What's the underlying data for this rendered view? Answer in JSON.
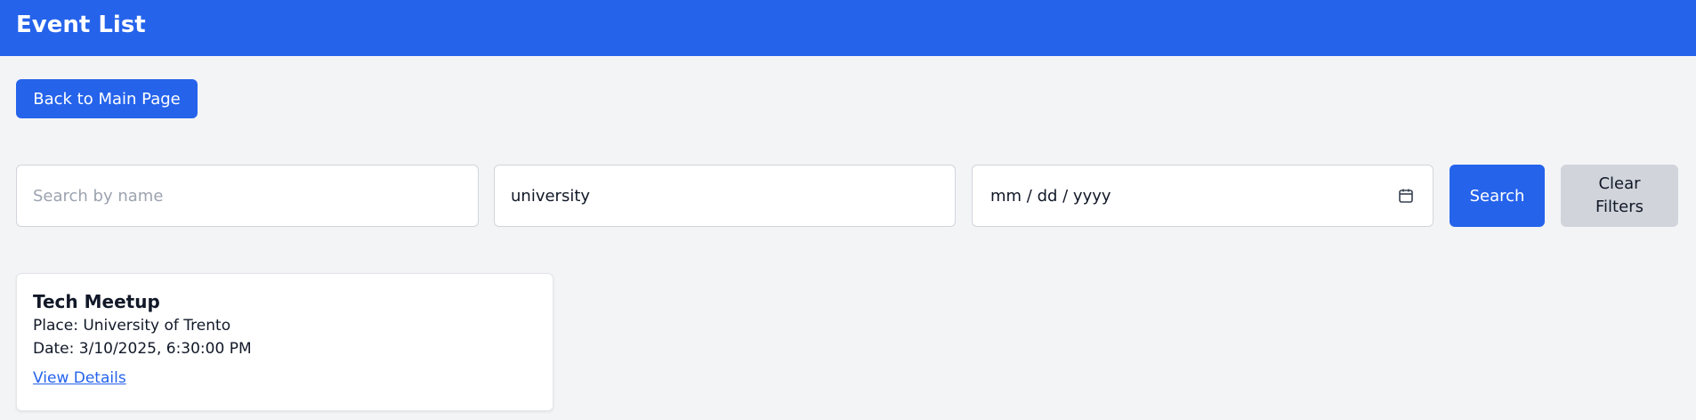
{
  "header": {
    "title": "Event List",
    "color": "#2563eb"
  },
  "nav": {
    "back_label": "Back to Main Page"
  },
  "filters": {
    "name": {
      "placeholder": "Search by name",
      "value": ""
    },
    "place": {
      "placeholder": "",
      "value": "university"
    },
    "date": {
      "value_display": "mm / dd / yyyy",
      "icon": "calendar-icon"
    },
    "search_label": "Search",
    "clear_label": "Clear Filters"
  },
  "events": [
    {
      "title": "Tech Meetup",
      "place_label": "Place:",
      "place": "University of Trento",
      "date_label": "Date:",
      "date": "3/10/2025, 6:30:00 PM",
      "link_label": "View Details"
    }
  ]
}
